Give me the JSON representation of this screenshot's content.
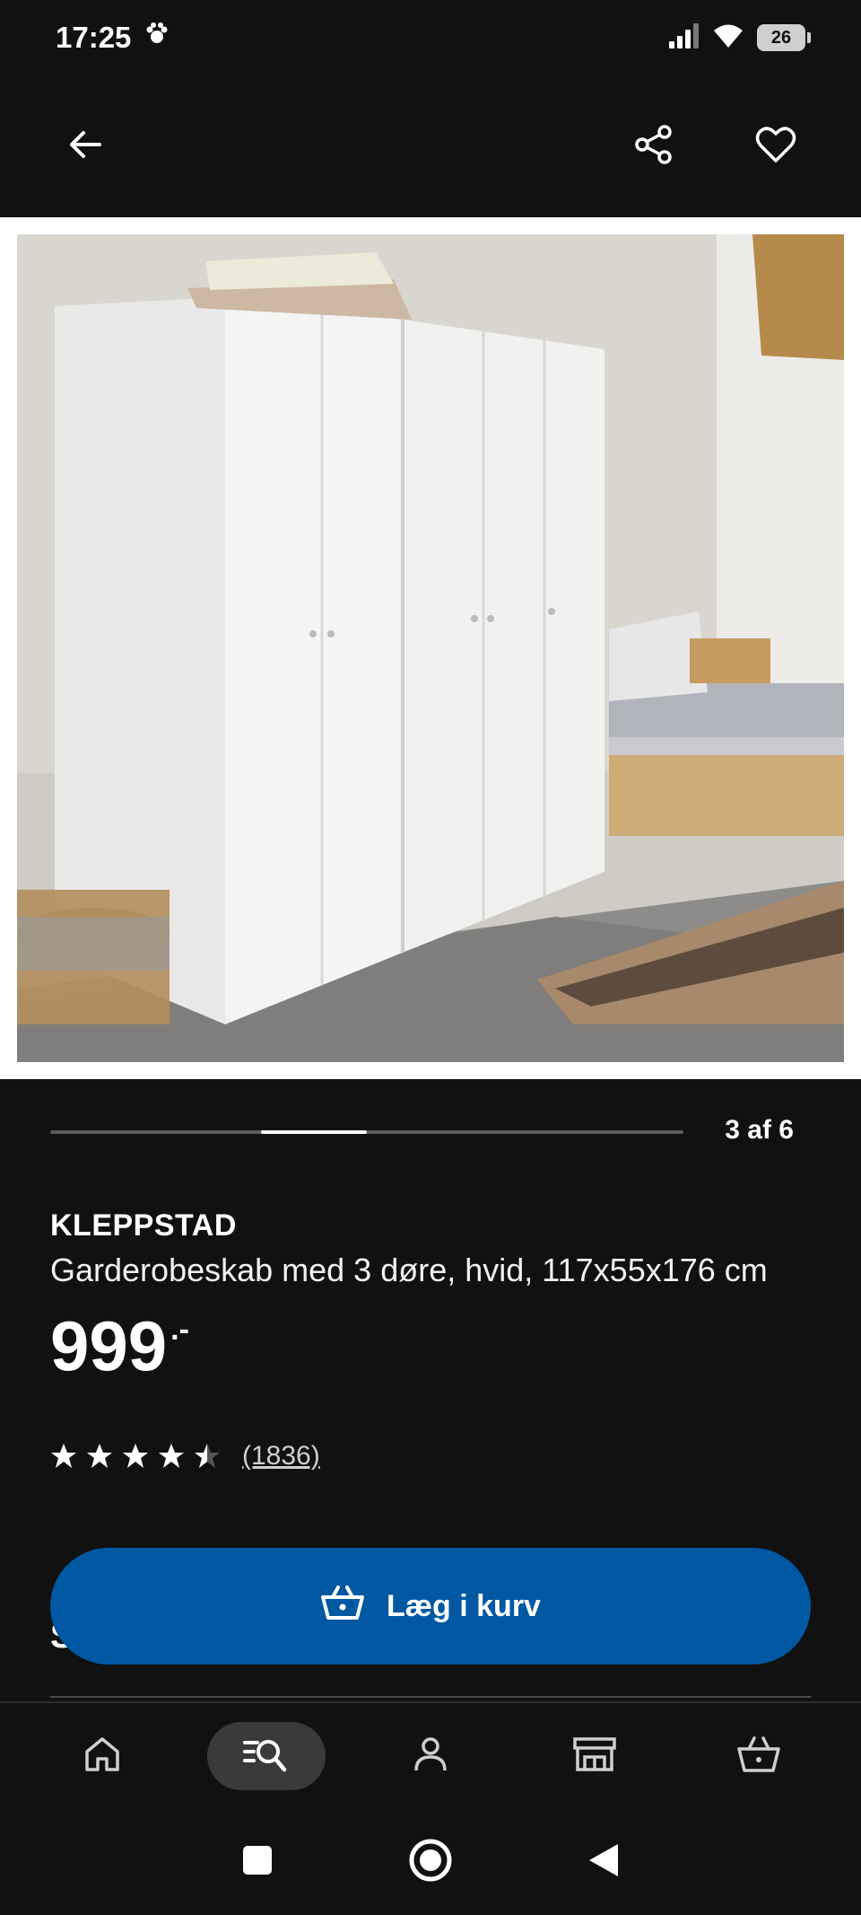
{
  "status_bar": {
    "time": "17:25",
    "battery_level": "26",
    "icons": [
      "notification-paw-icon",
      "signal-icon",
      "wifi-icon",
      "battery-icon"
    ]
  },
  "app_bar": {
    "icons": [
      "back-arrow-icon",
      "share-icon",
      "favorite-heart-icon"
    ]
  },
  "gallery": {
    "counter_text": "3 af 6",
    "current_index": 3,
    "total": 6
  },
  "product": {
    "brand": "KLEPPSTAD",
    "description": "Garderobeskab med 3 døre, hvid, 117x55x176 cm",
    "price": "999",
    "price_suffix": ".-",
    "rating": 4.5,
    "review_count": "(1836)"
  },
  "cta": {
    "label": "Læg i kurv",
    "icon": "basket-icon",
    "color": "#0058a3"
  },
  "partial_heading": "S",
  "bottom_nav": {
    "items": [
      {
        "name": "home",
        "icon": "home-icon",
        "active": false
      },
      {
        "name": "search",
        "icon": "search-list-icon",
        "active": true
      },
      {
        "name": "profile",
        "icon": "profile-icon",
        "active": false
      },
      {
        "name": "stores",
        "icon": "store-icon",
        "active": false
      },
      {
        "name": "cart",
        "icon": "basket-icon",
        "active": false
      }
    ]
  },
  "system_nav": {
    "icons": [
      "recents-square-icon",
      "home-circle-icon",
      "back-triangle-icon"
    ]
  }
}
